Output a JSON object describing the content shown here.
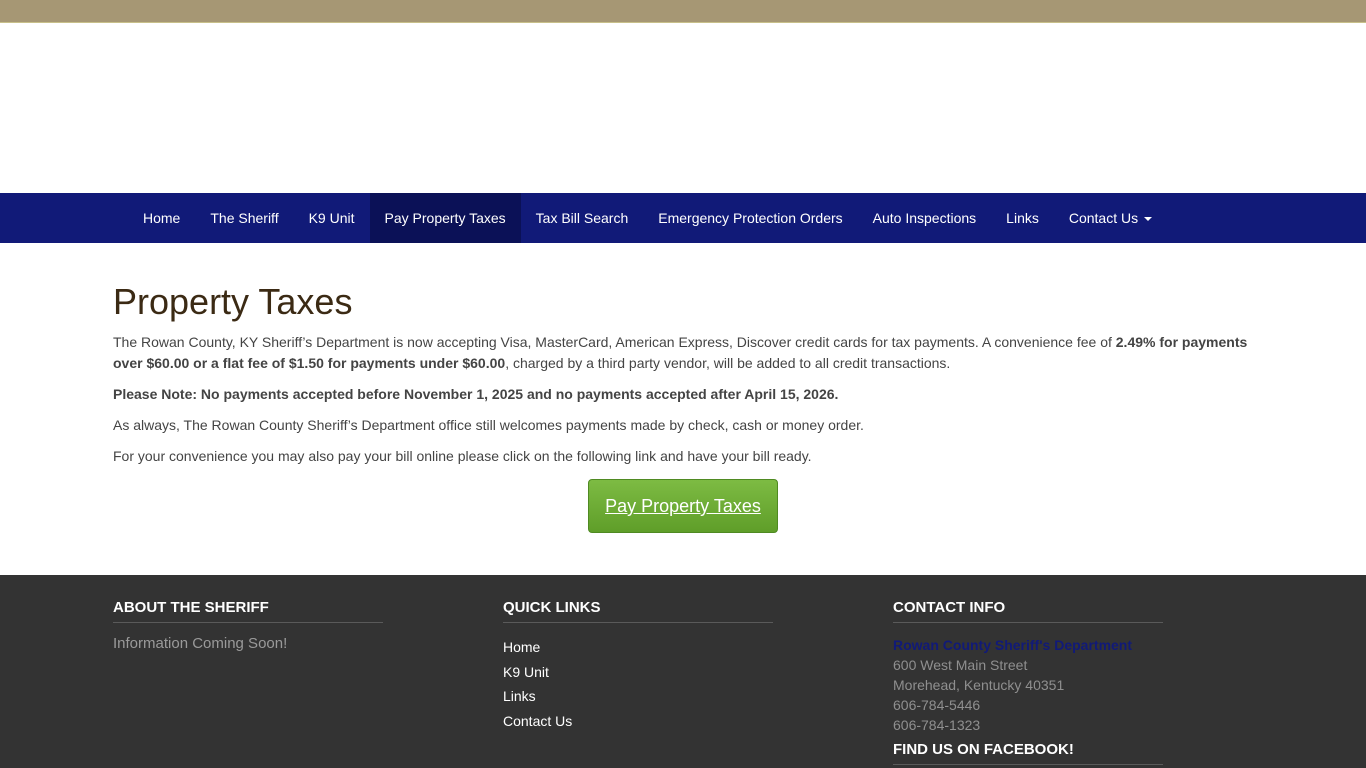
{
  "nav": {
    "items": [
      {
        "label": "Home"
      },
      {
        "label": "The Sheriff"
      },
      {
        "label": "K9 Unit"
      },
      {
        "label": "Pay Property Taxes"
      },
      {
        "label": "Tax Bill Search"
      },
      {
        "label": "Emergency Protection Orders"
      },
      {
        "label": "Auto Inspections"
      },
      {
        "label": "Links"
      },
      {
        "label": "Contact Us"
      }
    ]
  },
  "main": {
    "title": "Property Taxes",
    "p1_a": "The Rowan County, KY Sheriff’s Department is now accepting Visa, MasterCard, American Express, Discover credit cards for tax payments. A convenience fee of ",
    "p1_b": "2.49% for payments over $60.00 or a flat fee of $1.50 for payments under $60.00",
    "p1_c": ", charged by a third party vendor, will be added to all credit transactions.",
    "note": "Please Note: No payments accepted before November 1, 2025 and no payments accepted after April 15, 2026.",
    "p3": "As always, The Rowan County Sheriff’s Department office still welcomes payments made by check, cash or money order.",
    "p4": "For your convenience you may also pay your bill online please click on the following link and have your bill ready.",
    "button_label": "Pay Property Taxes"
  },
  "footer": {
    "about": {
      "heading": "ABOUT THE SHERIFF",
      "text": "Information Coming Soon!"
    },
    "quick_links": {
      "heading": "QUICK LINKS",
      "links": [
        {
          "label": "Home"
        },
        {
          "label": "K9 Unit"
        },
        {
          "label": "Links"
        },
        {
          "label": "Contact Us"
        }
      ]
    },
    "contact": {
      "heading": "CONTACT INFO",
      "name": "Rowan County Sheriff's Department",
      "street": "600 West Main Street",
      "city": "Morehead, Kentucky 40351",
      "phone1": "606-784-5446",
      "phone2": "606-784-1323"
    },
    "facebook_heading": "FIND US ON FACEBOOK!"
  },
  "colors": {
    "topbar": "#a69774",
    "navbar": "#111a78",
    "nav_active": "#0b1157",
    "button": "#6aab32",
    "footer": "#333333"
  }
}
